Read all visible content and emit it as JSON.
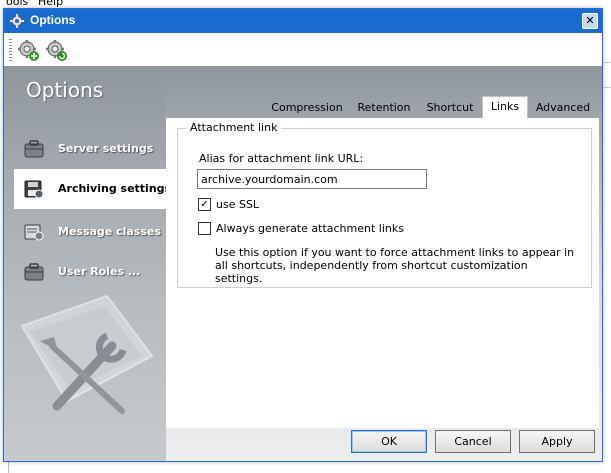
{
  "background_app": {
    "menu_items": [
      "ools",
      "Help"
    ]
  },
  "window": {
    "title": "Options",
    "close_glyph": "✕",
    "toolbar": {
      "buttons": [
        {
          "icon": "gear-add-icon"
        },
        {
          "icon": "gear-refresh-icon"
        }
      ]
    }
  },
  "header": {
    "title": "Options"
  },
  "sidebar": {
    "items": [
      {
        "label": "Server settings",
        "icon": "briefcase-icon",
        "active": false
      },
      {
        "label": "Archiving settings",
        "icon": "archive-save-icon",
        "active": true
      },
      {
        "label": "Message classes",
        "icon": "message-classes-icon",
        "active": false
      },
      {
        "label": "User Roles ...",
        "icon": "user-roles-icon",
        "active": false
      }
    ]
  },
  "tabs": [
    {
      "label": "Compression",
      "active": false
    },
    {
      "label": "Retention",
      "active": false
    },
    {
      "label": "Shortcut",
      "active": false
    },
    {
      "label": "Links",
      "active": true
    },
    {
      "label": "Advanced",
      "active": false
    }
  ],
  "links_tab": {
    "group_title": "Attachment link",
    "alias_label": "Alias for attachment link URL:",
    "alias_value": "archive.yourdomain.com",
    "use_ssl": {
      "label": "use SSL",
      "checked": true
    },
    "always_generate": {
      "label": "Always generate attachment links",
      "checked": false
    },
    "description": "Use this option if you want to force attachment links to appear in all shortcuts, independently from shortcut customization settings."
  },
  "buttons": {
    "ok": "OK",
    "cancel": "Cancel",
    "apply": "Apply"
  },
  "colors": {
    "titlebar": "#1a6bd0",
    "header_gray": "#8e959c"
  }
}
